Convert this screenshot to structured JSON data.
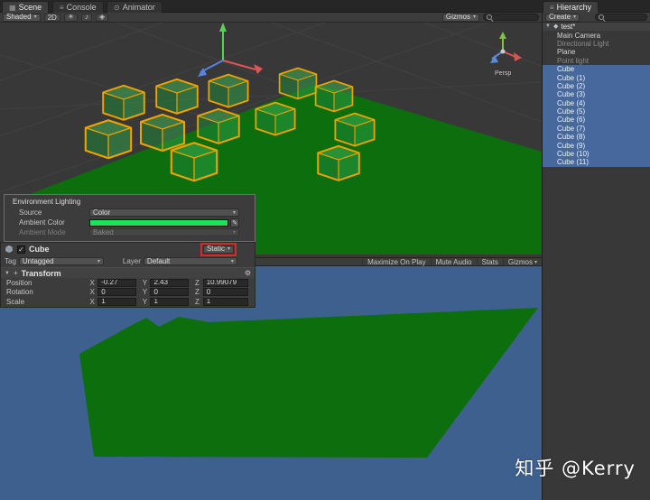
{
  "tabs": {
    "scene": "Scene",
    "console": "Console",
    "animator": "Animator",
    "hierarchy": "Hierarchy"
  },
  "icons": {
    "scene_tab": "▦",
    "console_tab": "≡",
    "animator_tab": "⊙",
    "hierarchy_tab": "≡",
    "dropdown_arrow": "▾",
    "foldout_open": "▼",
    "lighting_toggle": "☀",
    "audio_toggle": "♪",
    "effects_toggle": "◈",
    "scene_asset": "◆",
    "gear": "⚙",
    "check": "✓",
    "transform_tool": "+",
    "picker": "✎"
  },
  "scene_toolbar": {
    "shaded": "Shaded",
    "mode_2d": "2D",
    "gizmos": "Gizmos"
  },
  "scene_view": {
    "projection_label": "Persp"
  },
  "hierarchy": {
    "create_label": "Create",
    "scene_name": "test*",
    "items": [
      {
        "label": "Main Camera"
      },
      {
        "label": "Directional Light"
      },
      {
        "label": "Plane"
      },
      {
        "label": "Point light"
      },
      {
        "label": "Cube"
      },
      {
        "label": "Cube (1)"
      },
      {
        "label": "Cube (2)"
      },
      {
        "label": "Cube (3)"
      },
      {
        "label": "Cube (4)"
      },
      {
        "label": "Cube (5)"
      },
      {
        "label": "Cube (6)"
      },
      {
        "label": "Cube (7)"
      },
      {
        "label": "Cube (8)"
      },
      {
        "label": "Cube (9)"
      },
      {
        "label": "Cube (10)"
      },
      {
        "label": "Cube (11)"
      }
    ]
  },
  "lighting_panel": {
    "title": "Environment Lighting",
    "source_label": "Source",
    "source_value": "Color",
    "ambient_color_label": "Ambient Color",
    "ambient_color_hex": "#1ee25a",
    "ambient_mode_label": "Ambient Mode",
    "ambient_mode_value": "Baked"
  },
  "inspector": {
    "object_name": "Cube",
    "static_label": "Static",
    "tag_label": "Tag",
    "tag_value": "Untagged",
    "layer_label": "Layer",
    "layer_value": "Default",
    "transform": {
      "title": "Transform",
      "axis": {
        "x": "X",
        "y": "Y",
        "z": "Z"
      },
      "position": {
        "label": "Position",
        "x": "-0.27",
        "y": "2.43",
        "z": "10.99079"
      },
      "rotation": {
        "label": "Rotation",
        "x": "0",
        "y": "0",
        "z": "0"
      },
      "scale": {
        "label": "Scale",
        "x": "1",
        "y": "1",
        "z": "1"
      }
    }
  },
  "game_toolbar": {
    "maximize": "Maximize On Play",
    "mute": "Mute Audio",
    "stats": "Stats",
    "gizmos": "Gizmos"
  },
  "watermark": "知乎 @Kerry",
  "colors": {
    "selection_blue": "#46689c",
    "plane_green": "#0d6e0d",
    "game_background_blue": "#3e608f",
    "cube_outline_orange": "#f2a200",
    "ambient_swatch_green": "#1ee25a",
    "static_highlight_red": "#d42a2a"
  }
}
